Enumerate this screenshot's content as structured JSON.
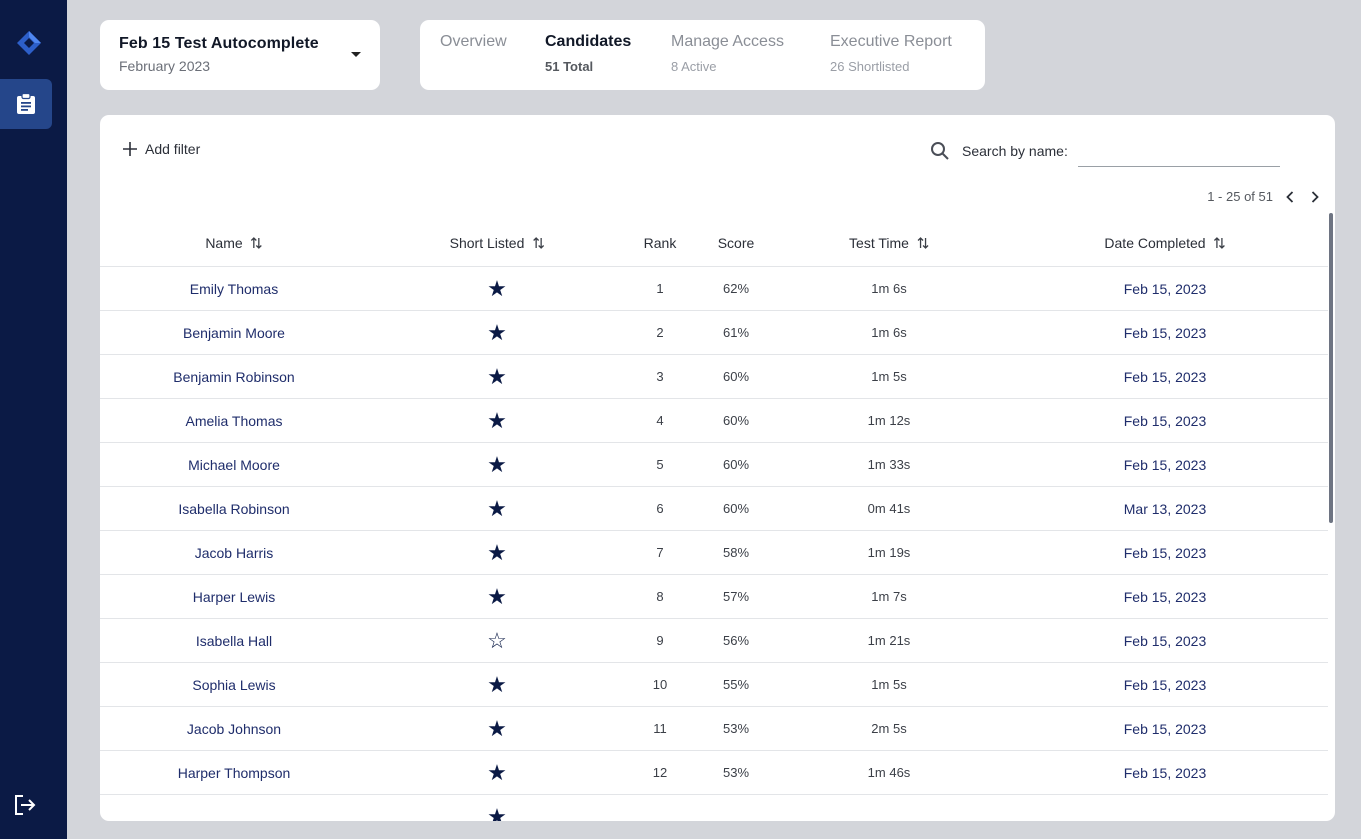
{
  "sidebar": {
    "logo_icon": "diamond-logo-icon",
    "active_icon": "clipboard-icon",
    "logout_icon": "logout-icon",
    "bg_color": "#0b1a45",
    "active_color": "#25468a"
  },
  "test_select": {
    "title": "Feb 15 Test Autocomplete",
    "subtitle": "February 2023"
  },
  "tabs": [
    {
      "label": "Overview",
      "sub": ""
    },
    {
      "label": "Candidates",
      "sub": "51 Total"
    },
    {
      "label": "Manage Access",
      "sub": "8 Active"
    },
    {
      "label": "Executive Report",
      "sub": "26 Shortlisted"
    }
  ],
  "toolbar": {
    "add_filter_label": "Add filter",
    "search_label": "Search by name:",
    "search_value": ""
  },
  "pagination": {
    "range_text": "1 - 25 of 51"
  },
  "table": {
    "columns": [
      "Name",
      "Short Listed",
      "Rank",
      "Score",
      "Test Time",
      "Date Completed"
    ],
    "rows": [
      {
        "name": "Emily Thomas",
        "shortlisted": "★",
        "rank": "1",
        "score": "62%",
        "time": "1m 6s",
        "date": "Feb 15, 2023"
      },
      {
        "name": "Benjamin Moore",
        "shortlisted": "★",
        "rank": "2",
        "score": "61%",
        "time": "1m 6s",
        "date": "Feb 15, 2023"
      },
      {
        "name": "Benjamin Robinson",
        "shortlisted": "★",
        "rank": "3",
        "score": "60%",
        "time": "1m 5s",
        "date": "Feb 15, 2023"
      },
      {
        "name": "Amelia Thomas",
        "shortlisted": "★",
        "rank": "4",
        "score": "60%",
        "time": "1m 12s",
        "date": "Feb 15, 2023"
      },
      {
        "name": "Michael Moore",
        "shortlisted": "★",
        "rank": "5",
        "score": "60%",
        "time": "1m 33s",
        "date": "Feb 15, 2023"
      },
      {
        "name": "Isabella Robinson",
        "shortlisted": "★",
        "rank": "6",
        "score": "60%",
        "time": "0m 41s",
        "date": "Mar 13, 2023"
      },
      {
        "name": "Jacob Harris",
        "shortlisted": "★",
        "rank": "7",
        "score": "58%",
        "time": "1m 19s",
        "date": "Feb 15, 2023"
      },
      {
        "name": "Harper Lewis",
        "shortlisted": "★",
        "rank": "8",
        "score": "57%",
        "time": "1m 7s",
        "date": "Feb 15, 2023"
      },
      {
        "name": "Isabella Hall",
        "shortlisted": "☆",
        "rank": "9",
        "score": "56%",
        "time": "1m 21s",
        "date": "Feb 15, 2023"
      },
      {
        "name": "Sophia Lewis",
        "shortlisted": "★",
        "rank": "10",
        "score": "55%",
        "time": "1m 5s",
        "date": "Feb 15, 2023"
      },
      {
        "name": "Jacob Johnson",
        "shortlisted": "★",
        "rank": "11",
        "score": "53%",
        "time": "2m 5s",
        "date": "Feb 15, 2023"
      },
      {
        "name": "Harper Thompson",
        "shortlisted": "★",
        "rank": "12",
        "score": "53%",
        "time": "1m 46s",
        "date": "Feb 15, 2023"
      },
      {
        "name": "",
        "shortlisted": "★",
        "rank": "",
        "score": "",
        "time": "",
        "date": ""
      }
    ]
  },
  "colors": {
    "link": "#1f2d6b",
    "star": "#0b1a45",
    "page_bg": "#d3d5da"
  }
}
